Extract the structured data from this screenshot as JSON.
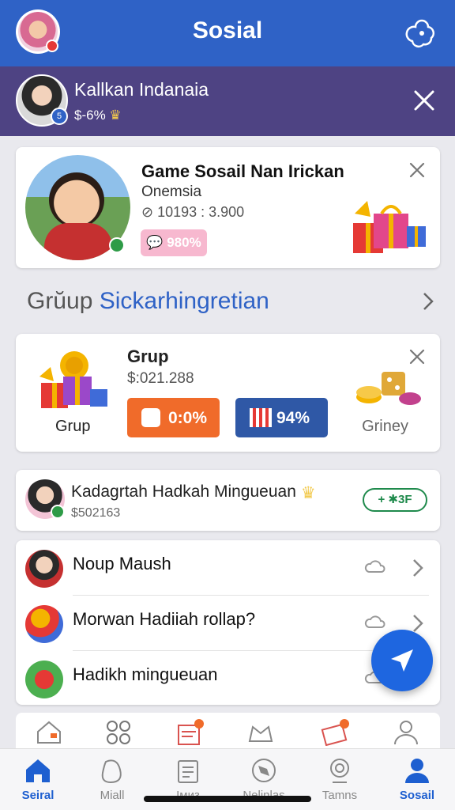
{
  "header": {
    "title": "Sosial",
    "avatar_icon": "user-avatar",
    "action_icon": "cloud-flower-icon",
    "color": "#2f62c6"
  },
  "banner": {
    "name": "Kallkan Indanaia",
    "sub": "$-6%",
    "badge": "5",
    "close_icon": "close-icon",
    "color": "#4e4383"
  },
  "game_card": {
    "title": "Game Sosail Nan Irickan",
    "subtitle": "Onemsia",
    "stat": "10193 : 3.900",
    "pill": "980%",
    "close_icon": "close-icon"
  },
  "section": {
    "prefix": "Grŭup",
    "highlight": "Sickarhingretian"
  },
  "group_card": {
    "title": "Grup",
    "value": "$:021.288",
    "left_label": "Grup",
    "right_label": "Griney",
    "button_orange": "0:0%",
    "button_blue": "94%",
    "colors": {
      "orange": "#f06b2a",
      "blue": "#2f58a6"
    }
  },
  "user_row": {
    "name": "Kadagrtah Hadkah Minguеuan",
    "sub": "$502163",
    "tag": "+ ✱3F"
  },
  "list": [
    {
      "label": "Noup Maush"
    },
    {
      "label": "Morwan Hadiiah rollap?"
    },
    {
      "label": "Hadikh minguеuan"
    }
  ],
  "fab_icon": "navigation-arrow-icon",
  "tabs": [
    {
      "label": "Seiral",
      "icon": "home-icon",
      "active": true
    },
    {
      "label": "Miall",
      "icon": "bean-icon",
      "active": false
    },
    {
      "label": "Iмиз",
      "icon": "clipboard-icon",
      "active": false
    },
    {
      "label": "Nelinlas",
      "icon": "compass-icon",
      "active": false
    },
    {
      "label": "Tamns",
      "icon": "badge-icon",
      "active": false
    },
    {
      "label": "Sosail",
      "icon": "person-icon",
      "active": true
    }
  ]
}
